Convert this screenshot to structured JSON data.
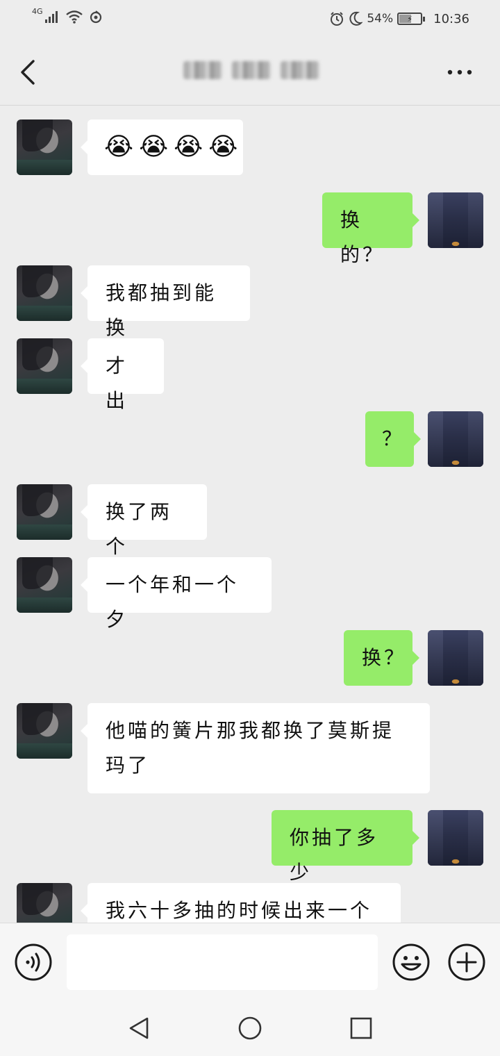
{
  "status_bar": {
    "network": "4G",
    "battery": "54%",
    "time": "10:36",
    "icons": [
      "signal-icon",
      "wifi-icon",
      "data-saver-icon",
      "alarm-icon",
      "moon-icon",
      "battery-icon"
    ]
  },
  "header": {
    "back_icon": "chevron-left-icon",
    "more_icon": "more-dots-icon"
  },
  "messages": [
    {
      "side": "left",
      "type": "emoji",
      "emojis": [
        "😭",
        "😭",
        "😭",
        "😭"
      ]
    },
    {
      "side": "right",
      "text": "换的？"
    },
    {
      "side": "left",
      "text": "我都抽到能换"
    },
    {
      "side": "left",
      "text": "才出"
    },
    {
      "side": "right",
      "text": "？"
    },
    {
      "side": "left",
      "text": "换了两个"
    },
    {
      "side": "left",
      "text": "一个年和一个夕"
    },
    {
      "side": "right",
      "text": "换？"
    },
    {
      "side": "left",
      "text": "他喵的簧片那我都换了莫斯提玛了"
    },
    {
      "side": "right",
      "text": "你抽了多少"
    },
    {
      "side": "left",
      "text": "我六十多抽的时候出来一个夕"
    }
  ],
  "input_bar": {
    "placeholder": "",
    "icons": [
      "voice-icon",
      "emoji-icon",
      "plus-icon"
    ]
  },
  "nav_bar": {
    "icons": [
      "nav-back-icon",
      "nav-home-icon",
      "nav-recent-icon"
    ]
  },
  "colors": {
    "background": "#ededed",
    "self_bubble": "#95ec69",
    "friend_bubble": "#ffffff"
  }
}
